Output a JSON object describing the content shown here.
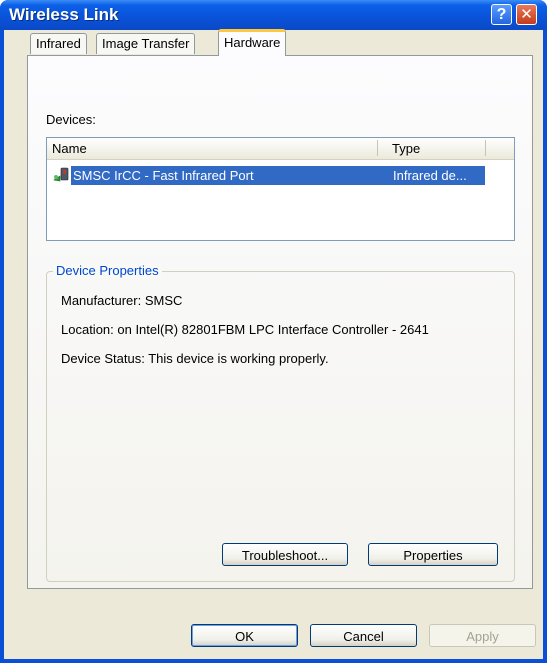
{
  "window": {
    "title": "Wireless Link"
  },
  "titlebar": {
    "help_glyph": "?",
    "close_glyph": "✕"
  },
  "tabs": [
    {
      "label": "Infrared",
      "active": false
    },
    {
      "label": "Image Transfer",
      "active": false
    },
    {
      "label": "Hardware",
      "active": true
    }
  ],
  "devices": {
    "label": "Devices:",
    "columns": [
      "Name",
      "Type"
    ],
    "rows": [
      {
        "name": "SMSC IrCC - Fast Infrared Port",
        "type": "Infrared de...",
        "icon": "infrared-device-icon",
        "selected": true
      }
    ]
  },
  "properties": {
    "title": "Device Properties",
    "manufacturer": "Manufacturer: SMSC",
    "location": "Location: on Intel(R) 82801FBM LPC Interface Controller - 2641",
    "status": "Device Status: This device is working properly.",
    "troubleshoot_label": "Troubleshoot...",
    "properties_label": "Properties"
  },
  "footer": {
    "ok_label": "OK",
    "cancel_label": "Cancel",
    "apply_label": "Apply"
  },
  "colors": {
    "titlebar": "#0a52d8",
    "selection": "#316ac5",
    "group_title": "#0046d5",
    "tab_highlight": "#ffc83c"
  }
}
